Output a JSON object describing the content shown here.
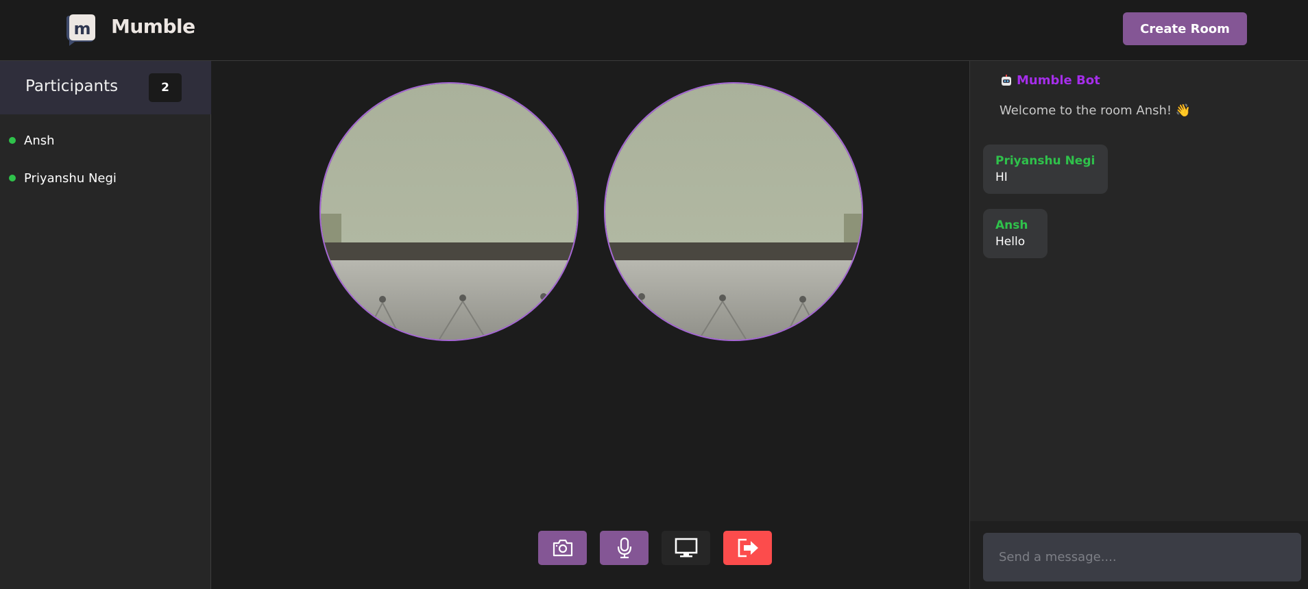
{
  "header": {
    "brand": "Mumble",
    "create_room_label": "Create Room"
  },
  "sidebar": {
    "title": "Participants",
    "count": "2",
    "participants": [
      {
        "name": "Ansh",
        "status_color": "#2fc24b"
      },
      {
        "name": "Priyanshu Negi",
        "status_color": "#2fc24b"
      }
    ]
  },
  "controls": [
    {
      "name": "camera-icon",
      "color": "#845695"
    },
    {
      "name": "microphone-icon",
      "color": "#845695"
    },
    {
      "name": "screen-share-icon",
      "color": "#262626"
    },
    {
      "name": "leave-icon",
      "color": "#fc4c4c"
    }
  ],
  "chat": {
    "bot": {
      "name": "Mumble Bot",
      "icon": "robot-icon",
      "message": "Welcome to the room Ansh! 👋"
    },
    "messages": [
      {
        "author": "Priyanshu Negi",
        "text": "HI"
      },
      {
        "author": "Ansh",
        "text": "Hello"
      }
    ],
    "input_placeholder": "Send a message...."
  },
  "colors": {
    "accent": "#845695",
    "online": "#2fc24b",
    "bot": "#a52eea",
    "danger": "#fc4c4c"
  }
}
